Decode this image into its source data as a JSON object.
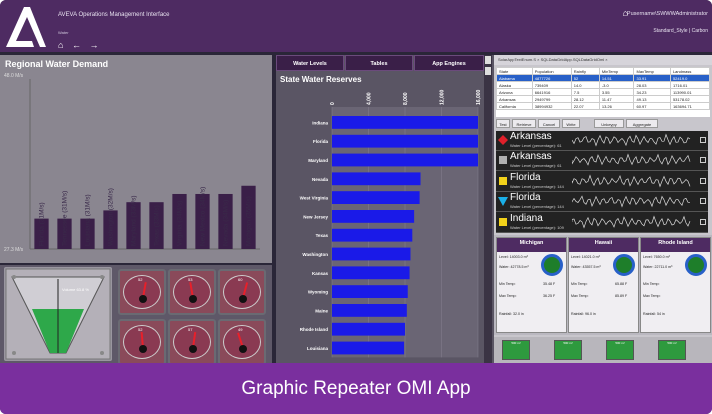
{
  "app": {
    "title": "AVEVA Operations Management Interface",
    "subtitle": "Water",
    "user": "Pusername\\SWWWAdministrator",
    "links": "Standard_Style  |  Carbon"
  },
  "left": {
    "title": "Regional Water Demand",
    "yTop": "48.0 M/s",
    "yBottom": "27.3 M/s"
  },
  "mid": {
    "tabs": [
      "Water Levels",
      "Tables",
      "App Engines"
    ],
    "title": "State Water Reserves"
  },
  "right": {
    "tabStrip": "SolarAppTextEnum.S  ×   SQLDataGridApp.SQLDataGridOml  ×",
    "gridCols": [
      "State",
      "Population",
      "Rainfly",
      "MinTemp",
      "MaxTemp",
      "Landmass"
    ],
    "gridRows": [
      [
        "Alabama",
        "4877726",
        "52",
        "14.51",
        "33.91",
        "52419.0"
      ],
      [
        "Alaska",
        "739409",
        "14.0",
        "-3.0",
        "28.03",
        "1716.01"
      ],
      [
        "Arizona",
        "6641916",
        "7.5",
        "3.55",
        "34.23",
        "113990.01"
      ],
      [
        "Arkansas",
        "2949799",
        "28.12",
        "11.47",
        "49.13",
        "53178.02"
      ],
      [
        "California",
        "38994932",
        "22.07",
        "13.26",
        "60.97",
        "163694.71"
      ]
    ],
    "buttons": [
      "Test",
      "Retrieve",
      "Cancel",
      "Write",
      "Unkeypy",
      "Aggregate"
    ],
    "alarms": [
      {
        "name": "Arkansas",
        "sub": "Water Level (percentage): 61",
        "color": "#e0202a",
        "shape": "diamond"
      },
      {
        "name": "Arkansas",
        "sub": "Water Level (percentage): 61",
        "color": "#b0b0b0",
        "shape": "square"
      },
      {
        "name": "Florida",
        "sub": "Water Level (percentage): 144",
        "color": "#f2d21a",
        "shape": "square"
      },
      {
        "name": "Florida",
        "sub": "Water Level (percentage): 144",
        "color": "#1ab0e8",
        "shape": "triangle"
      },
      {
        "name": "Indiana",
        "sub": "Water Level (percentage): 109",
        "color": "#f2d21a",
        "shape": "square"
      }
    ],
    "cards": [
      {
        "name": "Michigan",
        "level": "Level: 14003.0 m³",
        "water": "Water: 42778.5 m³",
        "min": "Min Temp:",
        "minv": "35.48 F",
        "max": "Max Temp:",
        "maxv": "36.25 F",
        "rain": "Rainfall: 32.0 in"
      },
      {
        "name": "Hawaii",
        "level": "Level: 14021.0 m³",
        "water": "Water: 43557.5 m³",
        "min": "Min Temp:",
        "minv": "65.88 F",
        "max": "Max Temp:",
        "maxv": "85.89 F",
        "rain": "Rainfall: 96.0 in"
      },
      {
        "name": "Rhode Island",
        "level": "Level: 7650.0 m³",
        "water": "Water: 22711.0 m³",
        "min": "Min Temp:",
        "minv": "",
        "max": "Max Temp:",
        "maxv": "",
        "rain": "Rainfall: 54 in"
      }
    ],
    "tanks": [
      "500 m³",
      "500 m³",
      "500 m³",
      "500 m³"
    ]
  },
  "gauges": [
    {
      "label": "52",
      "angle": 10
    },
    {
      "label": "53",
      "angle": -10
    },
    {
      "label": "60",
      "angle": 15
    },
    {
      "label": "52",
      "angle": -5
    },
    {
      "label": "57",
      "angle": 8
    },
    {
      "label": "49",
      "angle": -18
    }
  ],
  "funnel": {
    "label": "Volume 63.8 %"
  },
  "banner": "Graphic Repeater OMI App",
  "chart_data": [
    {
      "type": "bar",
      "title": "Regional Water Demand",
      "categories": [
        "Florida (31M/s)",
        "Tennessee (31M/s)",
        "Louisiana (31M/s)",
        "Washington (32M/s)",
        "Maryland (33M/s)",
        "Texas (33M/s)",
        "Virginia (34M/s)",
        "New Mexico (34M/s)",
        "Nevada (34M/s)",
        "Michigan (35M/s)"
      ],
      "values": [
        31,
        31,
        31,
        32,
        33,
        33,
        34,
        34,
        34,
        35
      ],
      "ylim": [
        27.3,
        48.0
      ],
      "colors": [
        "#3a1f48"
      ]
    },
    {
      "type": "bar",
      "orientation": "horizontal",
      "title": "State Water Reserves",
      "categories": [
        "Indiana",
        "Florida",
        "Maryland",
        "Nevada",
        "West Virginia",
        "New Jersey",
        "Texas",
        "Washington",
        "Kansas",
        "Wyoming",
        "Maine",
        "Rhode Island",
        "Louisiana"
      ],
      "values": [
        16000,
        16000,
        16000,
        9700,
        9600,
        9000,
        8800,
        8600,
        8500,
        8300,
        8200,
        8000,
        7900
      ],
      "xticks": [
        "0",
        "4,000",
        "8,000",
        "12,000",
        "16,000"
      ],
      "xlim": [
        0,
        16000
      ],
      "colors": [
        "#1a1ae8"
      ]
    }
  ]
}
